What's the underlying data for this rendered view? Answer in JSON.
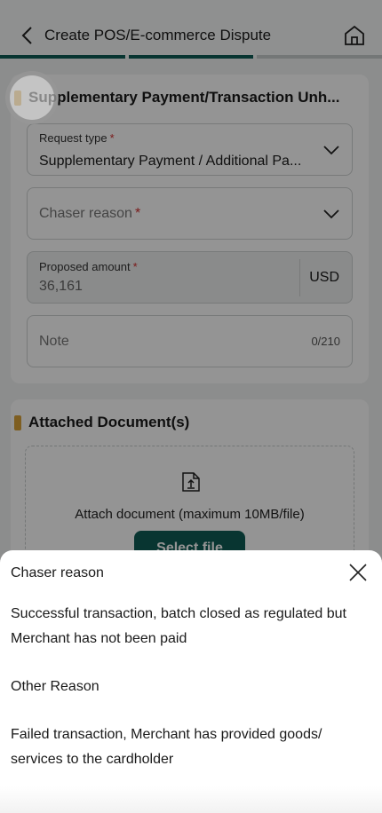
{
  "header": {
    "title": "Create POS/E-commerce Dispute",
    "progress_colors": [
      "#0f5c55",
      "#0f5c55",
      "#c9cdcd"
    ]
  },
  "form": {
    "section_title": "Supplementary Payment/Transaction Unh...",
    "request_type": {
      "label": "Request type",
      "required": "*",
      "value": "Supplementary Payment / Additional Pa..."
    },
    "chaser_reason": {
      "placeholder": "Chaser reason",
      "required": "*"
    },
    "proposed_amount": {
      "label": "Proposed amount",
      "required": "*",
      "value": "36,161",
      "currency": "USD"
    },
    "note": {
      "placeholder": "Note",
      "counter": "0/210"
    }
  },
  "attachments": {
    "section_title": "Attached Document(s)",
    "hint": "Attach document (maximum 10MB/file)",
    "select_label": "Select file"
  },
  "sheet": {
    "title": "Chaser reason",
    "options": [
      "Successful transaction, batch closed as regulated but Merchant has not been paid",
      "Other Reason",
      "Failed transaction, Merchant has provided goods/ services to the cardholder"
    ]
  },
  "colors": {
    "accent": "#0f5c55",
    "section_bar": "#d9a23a",
    "required": "#d32f2f"
  }
}
